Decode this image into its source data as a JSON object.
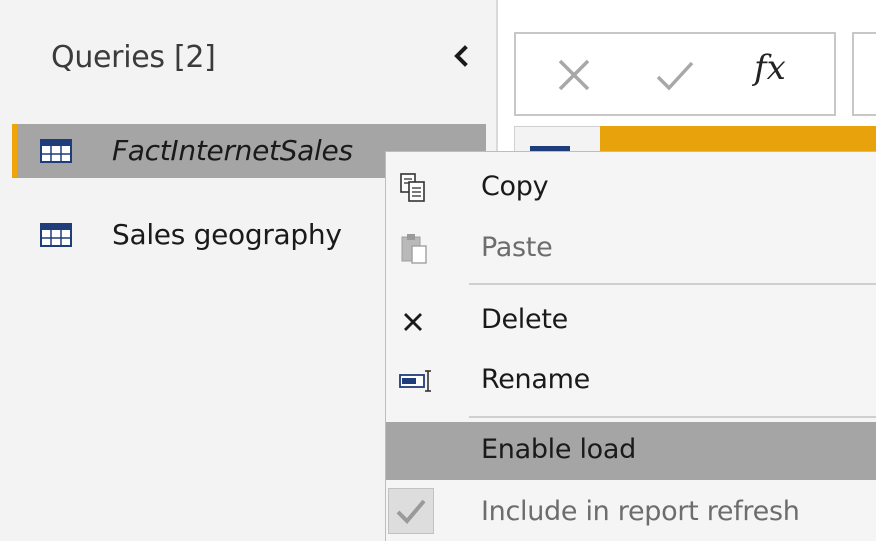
{
  "queries_pane": {
    "title": "Queries [2]",
    "collapse_icon": "chevron-left-icon",
    "items": [
      {
        "label": "FactInternetSales",
        "icon": "table-icon",
        "selected": true
      },
      {
        "label": "Sales geography",
        "icon": "table-icon",
        "selected": false
      }
    ]
  },
  "formula_bar": {
    "cancel_icon": "cancel-x-icon",
    "commit_icon": "checkmark-icon",
    "fx_label": "fx"
  },
  "context_menu": {
    "items": [
      {
        "label": "Copy",
        "icon": "copy-icon",
        "enabled": true
      },
      {
        "label": "Paste",
        "icon": "paste-icon",
        "enabled": false
      },
      {
        "label": "Delete",
        "icon": "delete-x-icon",
        "enabled": true
      },
      {
        "label": "Rename",
        "icon": "rename-icon",
        "enabled": true
      },
      {
        "label": "Enable load",
        "icon": "",
        "enabled": true,
        "highlighted": true
      },
      {
        "label": "Include in report refresh",
        "icon": "checkbox-checked-icon",
        "enabled": false,
        "checked": true
      }
    ]
  },
  "colors": {
    "accent": "#f0a30a",
    "selection": "#a5a5a5",
    "pane_background": "#f3f3f3",
    "table_icon_blue": "#1f3d7a"
  }
}
